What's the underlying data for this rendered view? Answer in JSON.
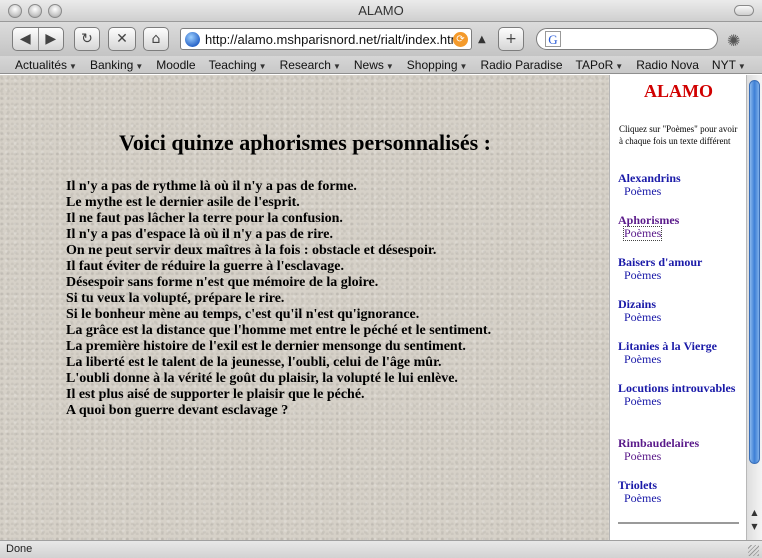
{
  "window": {
    "title": "ALAMO"
  },
  "toolbar": {
    "back_glyph": "◀",
    "forward_glyph": "▶",
    "reload_glyph": "↻",
    "stop_glyph": "✕",
    "home_glyph": "⌂",
    "url": "http://alamo.mshparisnord.net/rialt/index.htm",
    "add_glyph": "+",
    "search_value": "",
    "google_glyph": "G"
  },
  "bookmarks": [
    {
      "label": "Actualités",
      "menu": true
    },
    {
      "label": "Banking",
      "menu": true
    },
    {
      "label": "Moodle",
      "menu": false
    },
    {
      "label": "Teaching",
      "menu": true
    },
    {
      "label": "Research",
      "menu": true
    },
    {
      "label": "News",
      "menu": true
    },
    {
      "label": "Shopping",
      "menu": true
    },
    {
      "label": "Radio Paradise",
      "menu": false
    },
    {
      "label": "TAPoR",
      "menu": true
    },
    {
      "label": "Radio Nova",
      "menu": false
    },
    {
      "label": "NYT",
      "menu": true
    }
  ],
  "main": {
    "heading": "Voici quinze aphorismes personnalisés :",
    "aphorisms": [
      "Il n'y a pas de rythme là où il n'y a pas de forme.",
      "Le mythe est le dernier asile de l'esprit.",
      "Il ne faut pas lâcher la terre pour la confusion.",
      "Il n'y a pas d'espace là où il n'y a pas de rire.",
      "On ne peut servir deux maîtres à la fois : obstacle et désespoir.",
      "Il faut éviter de réduire la guerre à l'esclavage.",
      "Désespoir sans forme n'est que mémoire de la gloire.",
      "Si tu veux la volupté, prépare le rire.",
      "Si le bonheur mène au temps, c'est qu'il n'est qu'ignorance.",
      "La grâce est la distance que l'homme met entre le péché et le sentiment.",
      "La première histoire de l'exil est le dernier mensonge du sentiment.",
      "La liberté est le talent de la jeunesse, l'oubli, celui de l'âge mûr.",
      "L'oubli donne à la vérité le goût du plaisir, la volupté le lui enlève.",
      "Il est plus aisé de supporter le plaisir que le péché.",
      "A quoi bon guerre devant esclavage ?"
    ]
  },
  "sidebar": {
    "title": "ALAMO",
    "note": "Cliquez sur \"Poèmes\" pour avoir à chaque fois un texte différent",
    "groups": [
      {
        "heading": "Alexandrins",
        "link": "Poèmes",
        "visited": false,
        "focused": false
      },
      {
        "heading": "Aphorismes",
        "link": "Poèmes",
        "visited": true,
        "focused": true
      },
      {
        "heading": "Baisers d'amour",
        "link": "Poèmes",
        "visited": false,
        "focused": false
      },
      {
        "heading": "Dizains",
        "link": "Poèmes",
        "visited": false,
        "focused": false
      },
      {
        "heading": "Litanies à la Vierge",
        "link": "Poèmes",
        "visited": false,
        "focused": false
      },
      {
        "heading": "Locutions introuvables",
        "link": "Poèmes",
        "visited": false,
        "focused": false
      },
      {
        "heading": "Rimbaudelaires",
        "link": "Poèmes",
        "visited": true,
        "focused": false
      },
      {
        "heading": "Triolets",
        "link": "Poèmes",
        "visited": false,
        "focused": false
      }
    ]
  },
  "status": {
    "text": "Done"
  },
  "colors": {
    "sidebar_title": "#d10000",
    "link": "#1a1aa8",
    "visited_link": "#5a1a8a"
  }
}
